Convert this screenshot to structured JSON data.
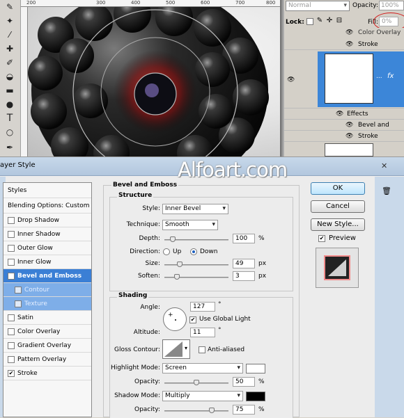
{
  "background": {
    "ruler_labels": [
      "200",
      "300",
      "400",
      "500",
      "600",
      "700",
      "800"
    ],
    "blend_mode": "Normal",
    "opacity_label": "Opacity:",
    "opacity_value": "100%",
    "lock_label": "Lock:",
    "fill_label": "Fill:",
    "fill_value": "0%",
    "layers": [
      {
        "label": "Color Overlay"
      },
      {
        "label": "Stroke"
      },
      {
        "label": "Effects"
      },
      {
        "label": "Bevel and Em..."
      },
      {
        "label": "Stroke"
      }
    ],
    "fx_label": "fx",
    "ellipsis": "..."
  },
  "watermark": "Alfoart.com",
  "dialog": {
    "title": "ayer Style",
    "styles_header": "Styles",
    "blending_options": "Blending Options: Custom",
    "style_items": [
      {
        "label": "Drop Shadow",
        "checked": false
      },
      {
        "label": "Inner Shadow",
        "checked": false
      },
      {
        "label": "Outer Glow",
        "checked": false
      },
      {
        "label": "Inner Glow",
        "checked": false
      },
      {
        "label": "Bevel and Emboss",
        "checked": true
      },
      {
        "label": "Contour",
        "checked": false
      },
      {
        "label": "Texture",
        "checked": false
      },
      {
        "label": "Satin",
        "checked": false
      },
      {
        "label": "Color Overlay",
        "checked": false
      },
      {
        "label": "Gradient Overlay",
        "checked": false
      },
      {
        "label": "Pattern Overlay",
        "checked": false
      },
      {
        "label": "Stroke",
        "checked": true
      }
    ],
    "section_title": "Bevel and Emboss",
    "structure": {
      "title": "Structure",
      "style_label": "Style:",
      "style_value": "Inner Bevel",
      "technique_label": "Technique:",
      "technique_value": "Smooth",
      "depth_label": "Depth:",
      "depth_value": "100",
      "depth_unit": "%",
      "direction_label": "Direction:",
      "direction_up": "Up",
      "direction_down": "Down",
      "size_label": "Size:",
      "size_value": "49",
      "size_unit": "px",
      "soften_label": "Soften:",
      "soften_value": "3",
      "soften_unit": "px"
    },
    "shading": {
      "title": "Shading",
      "angle_label": "Angle:",
      "angle_value": "127",
      "angle_unit": "°",
      "global_light_label": "Use Global Light",
      "global_light_checked": true,
      "altitude_label": "Altitude:",
      "altitude_value": "11",
      "altitude_unit": "°",
      "gloss_label": "Gloss Contour:",
      "anti_aliased_label": "Anti-aliased",
      "highlight_mode_label": "Highlight Mode:",
      "highlight_mode_value": "Screen",
      "highlight_color": "#ffffff",
      "opacity1_label": "Opacity:",
      "opacity1_value": "50",
      "opacity1_unit": "%",
      "shadow_mode_label": "Shadow Mode:",
      "shadow_mode_value": "Multiply",
      "shadow_color": "#000000",
      "opacity2_label": "Opacity:",
      "opacity2_value": "75",
      "opacity2_unit": "%"
    },
    "buttons": {
      "ok": "OK",
      "cancel": "Cancel",
      "new_style": "New Style...",
      "preview": "Preview"
    },
    "preview_checked": true
  }
}
